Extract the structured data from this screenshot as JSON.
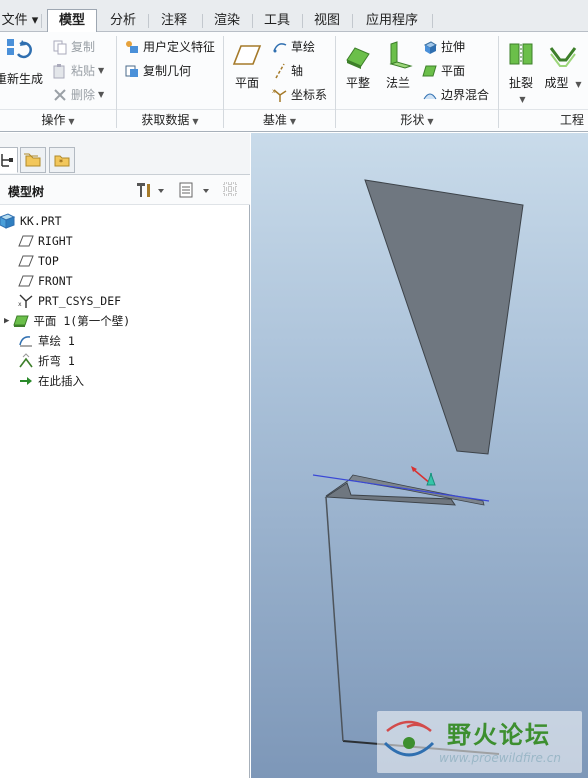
{
  "tabs": [
    {
      "label": "文件 ▾",
      "active": false
    },
    {
      "label": "模型",
      "active": true
    },
    {
      "label": "分析",
      "active": false
    },
    {
      "label": "注释",
      "active": false
    },
    {
      "label": "渲染",
      "active": false
    },
    {
      "label": "工具",
      "active": false
    },
    {
      "label": "视图",
      "active": false
    },
    {
      "label": "应用程序",
      "active": false
    }
  ],
  "ribbon": {
    "regen_label": "重新生成",
    "copy_label": "复制",
    "paste_label": "粘贴",
    "delete_label": "删除",
    "udf_label": "用户定义特征",
    "copy_geom_label": "复制几何",
    "plane_label": "平面",
    "sketch_label": "草绘",
    "axis_label": "轴",
    "csys_label": "坐标系",
    "flat_label": "平整",
    "flange_label": "法兰",
    "extrude_label": "拉伸",
    "planar_label": "平面",
    "boundary_blend_label": "边界混合",
    "rip_label": "扯裂",
    "form_label": "成型",
    "groups": {
      "operations": "操作",
      "get_data": "获取数据",
      "datum": "基准",
      "shapes": "形状",
      "engineering": "工程"
    }
  },
  "panel": {
    "title": "模型树"
  },
  "tree": [
    {
      "label": "KK.PRT",
      "icon": "part-icon"
    },
    {
      "label": "RIGHT",
      "icon": "datum-plane-icon"
    },
    {
      "label": "TOP",
      "icon": "datum-plane-icon"
    },
    {
      "label": "FRONT",
      "icon": "datum-plane-icon"
    },
    {
      "label": "PRT_CSYS_DEF",
      "icon": "csys-icon"
    },
    {
      "label": "平面 1(第一个壁)",
      "icon": "flat-wall-icon"
    },
    {
      "label": "草绘 1",
      "icon": "sketch-icon"
    },
    {
      "label": "折弯 1",
      "icon": "bend-icon"
    },
    {
      "label": "在此插入",
      "icon": "insert-arrow-icon"
    }
  ],
  "watermark": {
    "title": "野火论坛",
    "url": "www.proewildfire.cn"
  },
  "colors": {
    "active_tab_border": "#9ea7b2",
    "part_gray": "#6e7780",
    "viewport_top": "#c9dbea",
    "viewport_bottom": "#7d97b8",
    "watermark_green": "#3d8f2f"
  }
}
